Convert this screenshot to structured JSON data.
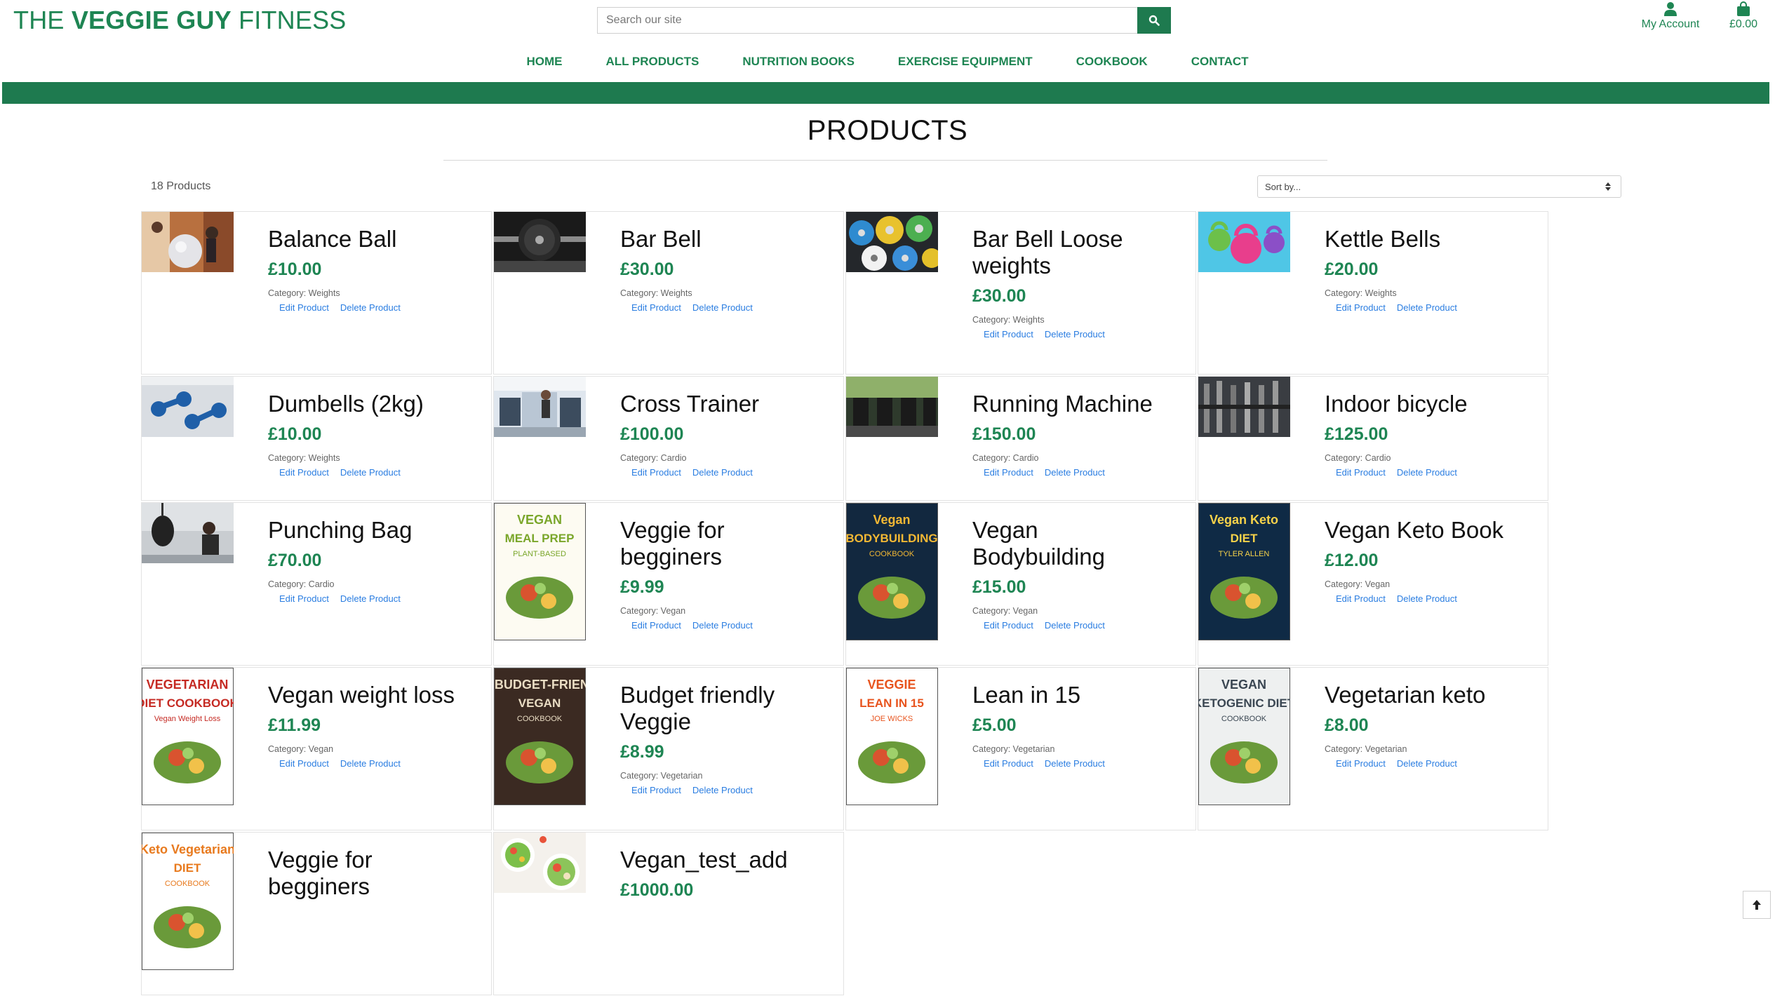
{
  "brand": {
    "pre": "THE ",
    "bold": "VEGGIE GUY",
    "post": " FITNESS"
  },
  "search": {
    "placeholder": "Search our site"
  },
  "account": {
    "label": "My Account"
  },
  "bag": {
    "total": "£0.00"
  },
  "nav": [
    "HOME",
    "ALL PRODUCTS",
    "NUTRITION BOOKS",
    "EXERCISE EQUIPMENT",
    "COOKBOOK",
    "CONTACT"
  ],
  "page": {
    "title": "PRODUCTS",
    "count": "18 Products"
  },
  "sort": {
    "selected": "Sort by..."
  },
  "labels": {
    "category_prefix": "Category: ",
    "edit": "Edit Product",
    "delete": "Delete Product"
  },
  "products": [
    {
      "name": "Balance Ball",
      "price": "£10.00",
      "category": "Weights",
      "img": "balance"
    },
    {
      "name": "Bar Bell",
      "price": "£30.00",
      "category": "Weights",
      "img": "barbell"
    },
    {
      "name": "Bar Bell Loose weights",
      "price": "£30.00",
      "category": "Weights",
      "img": "plates"
    },
    {
      "name": "Kettle Bells",
      "price": "£20.00",
      "category": "Weights",
      "img": "kettle"
    },
    {
      "name": "Dumbells (2kg)",
      "price": "£10.00",
      "category": "Weights",
      "img": "dumbbell"
    },
    {
      "name": "Cross Trainer",
      "price": "£100.00",
      "category": "Cardio",
      "img": "gym"
    },
    {
      "name": "Running Machine",
      "price": "£150.00",
      "category": "Cardio",
      "img": "treadmill"
    },
    {
      "name": "Indoor bicycle",
      "price": "£125.00",
      "category": "Cardio",
      "img": "rack"
    },
    {
      "name": "Punching Bag",
      "price": "£70.00",
      "category": "Cardio",
      "img": "punch"
    },
    {
      "name": "Veggie for begginers",
      "price": "£9.99",
      "category": "Vegan",
      "img": "book1",
      "book": {
        "lines": [
          "VEGAN",
          "MEAL PREP",
          "PLANT-BASED"
        ],
        "bg": "#fdfbf2",
        "fg": "#7aa62a"
      }
    },
    {
      "name": "Vegan Bodybuilding",
      "price": "£15.00",
      "category": "Vegan",
      "img": "book2",
      "book": {
        "lines": [
          "Vegan",
          "BODYBUILDING",
          "COOKBOOK"
        ],
        "bg": "#12283f",
        "fg": "#f2b834"
      }
    },
    {
      "name": "Vegan Keto Book",
      "price": "£12.00",
      "category": "Vegan",
      "img": "book3",
      "book": {
        "lines": [
          "Vegan Keto",
          "DIET",
          "TYLER ALLEN"
        ],
        "bg": "#0f2a45",
        "fg": "#f6d24a"
      }
    },
    {
      "name": "Vegan weight loss",
      "price": "£11.99",
      "category": "Vegan",
      "img": "book4",
      "book": {
        "lines": [
          "VEGETARIAN",
          "DIET COOKBOOK",
          "Vegan Weight Loss"
        ],
        "bg": "#ffffff",
        "fg": "#c52a23"
      }
    },
    {
      "name": "Budget friendly Veggie",
      "price": "£8.99",
      "category": "Vegetarian",
      "img": "book5",
      "book": {
        "lines": [
          "THE BUDGET-FRIENDLY",
          "VEGAN",
          "COOKBOOK"
        ],
        "bg": "#3b2a22",
        "fg": "#e9dcc3"
      }
    },
    {
      "name": "Lean in 15",
      "price": "£5.00",
      "category": "Vegetarian",
      "img": "book6",
      "book": {
        "lines": [
          "VEGGIE",
          "LEAN IN 15",
          "JOE WICKS"
        ],
        "bg": "#ffffff",
        "fg": "#e8541e"
      }
    },
    {
      "name": "Vegetarian keto",
      "price": "£8.00",
      "category": "Vegetarian",
      "img": "book7",
      "book": {
        "lines": [
          "VEGAN",
          "KETOGENIC DIET",
          "COOKBOOK"
        ],
        "bg": "#eef0f0",
        "fg": "#3a4652"
      }
    },
    {
      "name": "Veggie for begginers",
      "price": "",
      "category": "",
      "img": "book8",
      "book": {
        "lines": [
          "Keto Vegetarian",
          "DIET",
          "COOKBOOK"
        ],
        "bg": "#ffffff",
        "fg": "#e87a1e"
      }
    },
    {
      "name": "Vegan_test_add",
      "price": "£1000.00",
      "category": "",
      "img": "salad"
    }
  ],
  "colors": {
    "brand_green": "#1e8553",
    "bar_green": "#1e7a4f",
    "link_blue": "#2a7de1"
  }
}
